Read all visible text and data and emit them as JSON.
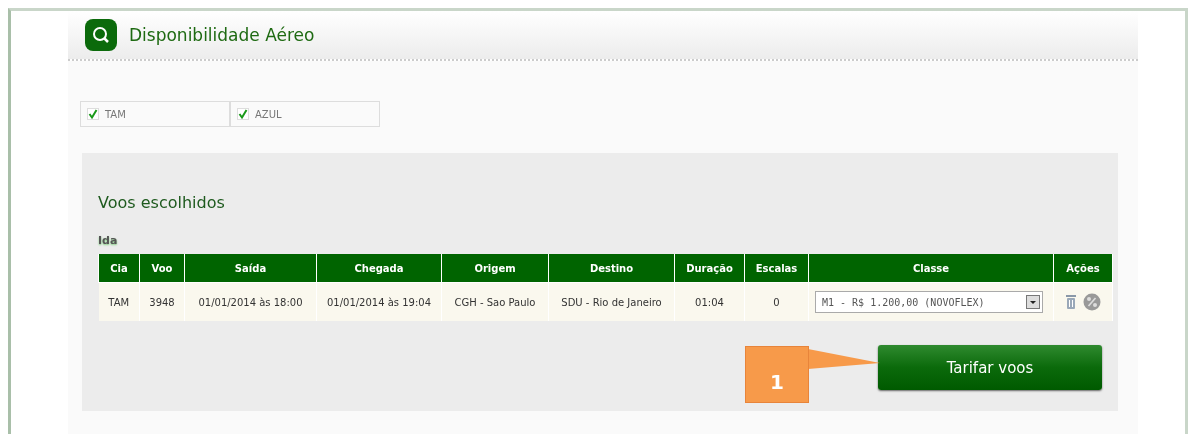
{
  "header": {
    "title": "Disponibilidade Aéreo"
  },
  "airlines": [
    {
      "label": "TAM",
      "checked": true
    },
    {
      "label": "AZUL",
      "checked": true
    }
  ],
  "section_title": "Voos escolhidos",
  "leg_label": "Ida",
  "table": {
    "columns": [
      "Cia",
      "Voo",
      "Saída",
      "Chegada",
      "Origem",
      "Destino",
      "Duração",
      "Escalas",
      "Classe",
      "Ações"
    ],
    "rows": [
      {
        "cells": [
          "TAM",
          "3948",
          "01/01/2014 às 18:00",
          "01/01/2014 às 19:04",
          "CGH - Sao Paulo",
          "SDU - Rio de Janeiro",
          "01:04",
          "0"
        ],
        "classe": "M1 - R$ 1.200,00 (NOVOFLEX)"
      }
    ]
  },
  "button": "Tarifar voos",
  "callout": "1"
}
